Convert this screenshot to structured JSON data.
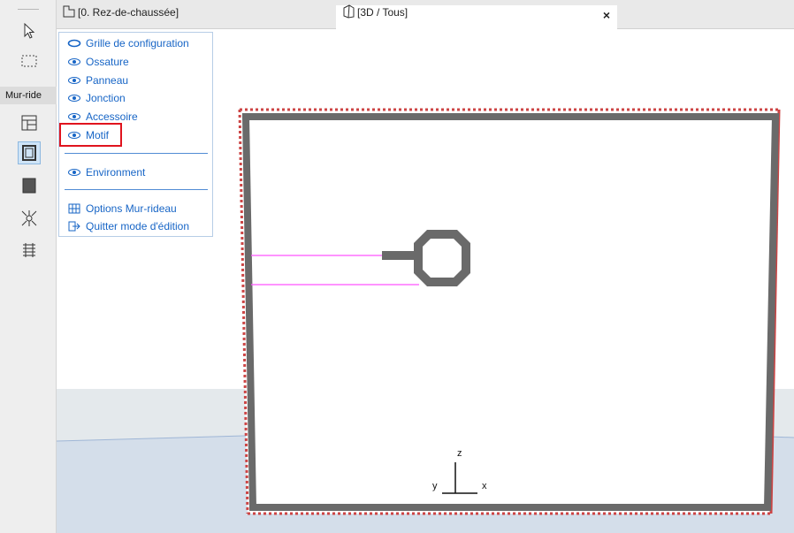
{
  "toolbox": {
    "section_label": "Mur-ride",
    "tools": [
      {
        "icon": "arrow-pointer-icon"
      },
      {
        "icon": "marquee-icon"
      },
      {
        "icon": "grid-layout-icon"
      },
      {
        "icon": "frame-icon",
        "selected": true
      },
      {
        "icon": "panel-icon"
      },
      {
        "icon": "junction-icon"
      },
      {
        "icon": "accessory-icon"
      }
    ]
  },
  "tabs": {
    "plan_label": "[0. Rez-de-chaussée]",
    "view3d_label": "[3D / Tous]",
    "close_symbol": "×"
  },
  "menu": {
    "items": [
      {
        "label": "Grille de configuration",
        "icon": "eye-closed-icon"
      },
      {
        "label": "Ossature",
        "icon": "eye-icon"
      },
      {
        "label": "Panneau",
        "icon": "eye-icon"
      },
      {
        "label": "Jonction",
        "icon": "eye-icon"
      },
      {
        "label": "Accessoire",
        "icon": "eye-icon"
      },
      {
        "label": "Motif",
        "icon": "eye-icon",
        "highlighted": true
      }
    ],
    "environment": {
      "label": "Environment",
      "icon": "eye-icon"
    },
    "options": {
      "label": "Options Mur-rideau",
      "icon": "grid-options-icon"
    },
    "quit": {
      "label": "Quitter mode d'édition",
      "icon": "exit-icon"
    }
  },
  "viewport": {
    "axis": {
      "z": "z",
      "y": "y",
      "x": "x"
    }
  },
  "colors": {
    "accent": "#1765c6",
    "highlight": "#e0141e",
    "frame": "#6a6a6a",
    "guide_line": "#ff55ff",
    "ground": "#d4deea",
    "horizon_band": "#e4e9ec"
  }
}
